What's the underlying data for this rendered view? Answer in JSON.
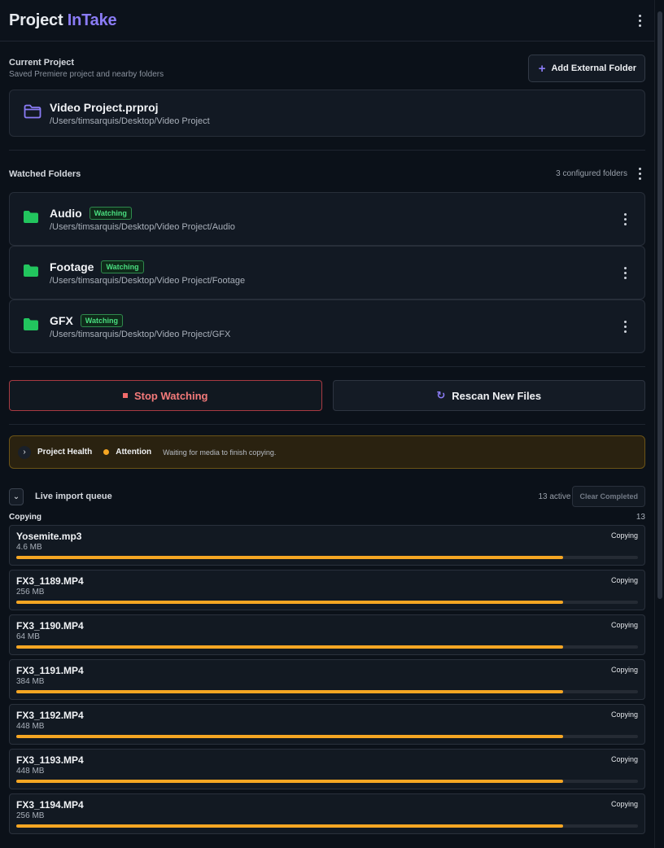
{
  "header": {
    "title_main": "Project",
    "title_accent": "InTake"
  },
  "current_project": {
    "title": "Current Project",
    "subtitle": "Saved Premiere project and nearby folders",
    "add_button_label": "Add External Folder",
    "project": {
      "name": "Video Project.prproj",
      "path": "/Users/timsarquis/Desktop/Video Project"
    }
  },
  "watched": {
    "title": "Watched Folders",
    "count_label": "3 configured folders",
    "folders": [
      {
        "name": "Audio",
        "badge": "Watching",
        "path": "/Users/timsarquis/Desktop/Video Project/Audio"
      },
      {
        "name": "Footage",
        "badge": "Watching",
        "path": "/Users/timsarquis/Desktop/Video Project/Footage"
      },
      {
        "name": "GFX",
        "badge": "Watching",
        "path": "/Users/timsarquis/Desktop/Video Project/GFX"
      }
    ]
  },
  "actions": {
    "stop_label": "Stop Watching",
    "rescan_label": "Rescan New Files"
  },
  "health": {
    "title": "Project Health",
    "status": "Attention",
    "message": "Waiting for media to finish copying.",
    "status_color": "#f5a623"
  },
  "queue": {
    "title": "Live import queue",
    "active_label": "13 active",
    "clear_label": "Clear Completed",
    "group_title": "Copying",
    "group_count": "13",
    "items": [
      {
        "name": "Yosemite.mp3",
        "size": "4.6 MB",
        "status": "Copying",
        "progress": 0.88
      },
      {
        "name": "FX3_1189.MP4",
        "size": "256 MB",
        "status": "Copying",
        "progress": 0.88
      },
      {
        "name": "FX3_1190.MP4",
        "size": "64 MB",
        "status": "Copying",
        "progress": 0.88
      },
      {
        "name": "FX3_1191.MP4",
        "size": "384 MB",
        "status": "Copying",
        "progress": 0.88
      },
      {
        "name": "FX3_1192.MP4",
        "size": "448 MB",
        "status": "Copying",
        "progress": 0.88
      },
      {
        "name": "FX3_1193.MP4",
        "size": "448 MB",
        "status": "Copying",
        "progress": 0.88
      },
      {
        "name": "FX3_1194.MP4",
        "size": "256 MB",
        "status": "Copying",
        "progress": 0.88
      }
    ]
  },
  "colors": {
    "accent": "#8b7cf6",
    "watching_green": "#4ade80",
    "folder_green": "#22c55e",
    "stop_red": "#f26b6b",
    "progress_amber": "#f5a623"
  },
  "icons": {
    "menu": "kebab-icon",
    "folder_outline": "folder-outline-icon",
    "folder_filled": "folder-icon",
    "plus": "plus-icon",
    "stop": "stop-icon",
    "rescan": "refresh-icon",
    "chevron": "chevron-icon"
  }
}
